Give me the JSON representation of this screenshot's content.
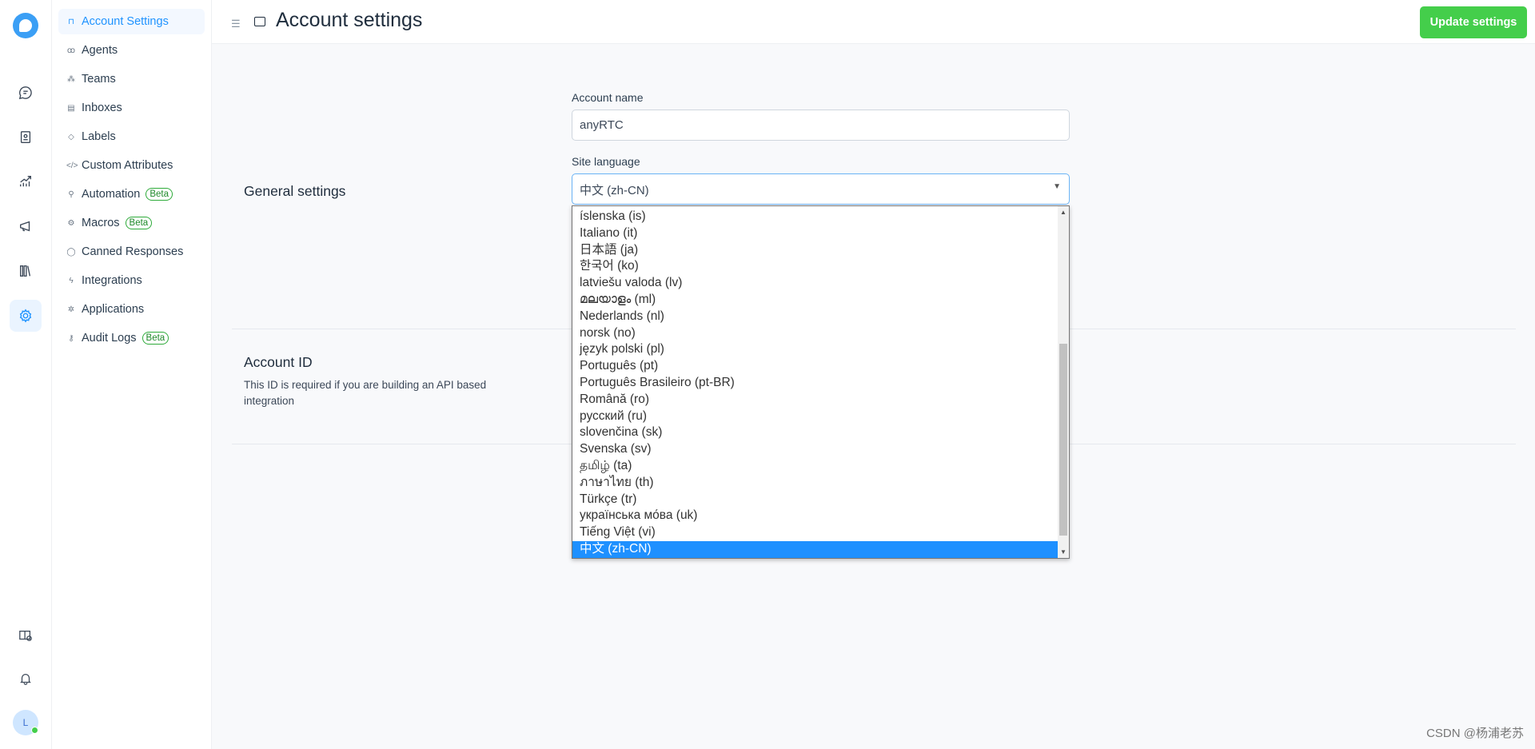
{
  "rail": {
    "icons": [
      "conversations-icon",
      "contacts-icon",
      "reports-icon",
      "campaigns-icon",
      "library-icon",
      "settings-icon"
    ],
    "bottom": [
      "help-center-icon",
      "bell-icon"
    ],
    "avatar": "L",
    "status_color": "#44ce4b"
  },
  "sidebar": {
    "items": [
      {
        "label": "Account Settings",
        "icon": "briefcase-icon",
        "glyph": "⊓",
        "active": true
      },
      {
        "label": "Agents",
        "icon": "agents-icon",
        "glyph": "ꝏ"
      },
      {
        "label": "Teams",
        "icon": "teams-icon",
        "glyph": "⁂"
      },
      {
        "label": "Inboxes",
        "icon": "inbox-icon",
        "glyph": "▤"
      },
      {
        "label": "Labels",
        "icon": "tag-icon",
        "glyph": "◇"
      },
      {
        "label": "Custom Attributes",
        "icon": "code-icon",
        "glyph": "</>"
      },
      {
        "label": "Automation",
        "icon": "automation-icon",
        "glyph": "⚲",
        "badge": "Beta"
      },
      {
        "label": "Macros",
        "icon": "macros-icon",
        "glyph": "⚙",
        "badge": "Beta"
      },
      {
        "label": "Canned Responses",
        "icon": "chat-icon",
        "glyph": "◯"
      },
      {
        "label": "Integrations",
        "icon": "lightning-icon",
        "glyph": "ϟ"
      },
      {
        "label": "Applications",
        "icon": "applications-icon",
        "glyph": "✲"
      },
      {
        "label": "Audit Logs",
        "icon": "key-icon",
        "glyph": "⚷",
        "badge": "Beta"
      }
    ]
  },
  "header": {
    "title": "Account settings",
    "update_label": "Update settings",
    "accent": "#44ce4b"
  },
  "general": {
    "heading": "General settings",
    "account_name_label": "Account name",
    "account_name_value": "anyRTC",
    "site_language_label": "Site language",
    "site_language_value": "中文 (zh-CN)"
  },
  "languages": [
    "íslenska (is)",
    "Italiano (it)",
    "日本語 (ja)",
    "한국어 (ko)",
    "latviešu valoda (lv)",
    "മലയാളം (ml)",
    "Nederlands (nl)",
    "norsk (no)",
    "język polski (pl)",
    "Português (pt)",
    "Português Brasileiro (pt-BR)",
    "Română (ro)",
    "русский (ru)",
    "slovenčina (sk)",
    "Svenska (sv)",
    "தமிழ் (ta)",
    "ภาษาไทย (th)",
    "Türkçe (tr)",
    "українська мо́ва (uk)",
    "Tiếng Việt (vi)",
    "中文 (zh-CN)"
  ],
  "selected_language": "中文 (zh-CN)",
  "account_id": {
    "heading": "Account ID",
    "description": "This ID is required if you are building an API based integration"
  },
  "watermark": "CSDN @杨浦老苏"
}
